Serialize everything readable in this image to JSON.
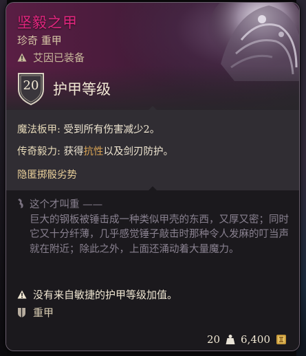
{
  "item": {
    "name": "坚毅之甲",
    "rarity_type": "珍奇 重甲",
    "equipped_by": "艾因已装备",
    "armor_class": "20",
    "armor_class_label": "护甲等级"
  },
  "properties": {
    "p1_key": "魔法板甲:",
    "p1_text": "受到所有伤害减少2。",
    "p2_key": "传奇毅力:",
    "p2_pre": "获得",
    "p2_hl": "抗性",
    "p2_post": "以及剑刃防护。",
    "p3": "隐匿掷骰劣势"
  },
  "flavor": {
    "title": "这个才叫重 ——",
    "body": "巨大的钢板被锤击成一种类似甲壳的东西，又厚又密；同时它又十分纤薄，几乎感觉锤子敲击时那种令人发麻的叮当声就在附近；除此之外，上面还涌动着大量魔力。"
  },
  "notes": {
    "no_dex": "没有来自敏捷的护甲等级加值。",
    "armor_type": "重甲"
  },
  "footer": {
    "weight": "20",
    "value": "6,400"
  },
  "colors": {
    "title": "#e0267e",
    "highlight": "#d9a455",
    "text": "#efe6d2",
    "flavor": "#8a8291"
  },
  "icons": [
    "warning-icon",
    "shield-icon",
    "quote-icon",
    "heavy-armor-icon",
    "weight-icon",
    "gold-coin-icon"
  ]
}
